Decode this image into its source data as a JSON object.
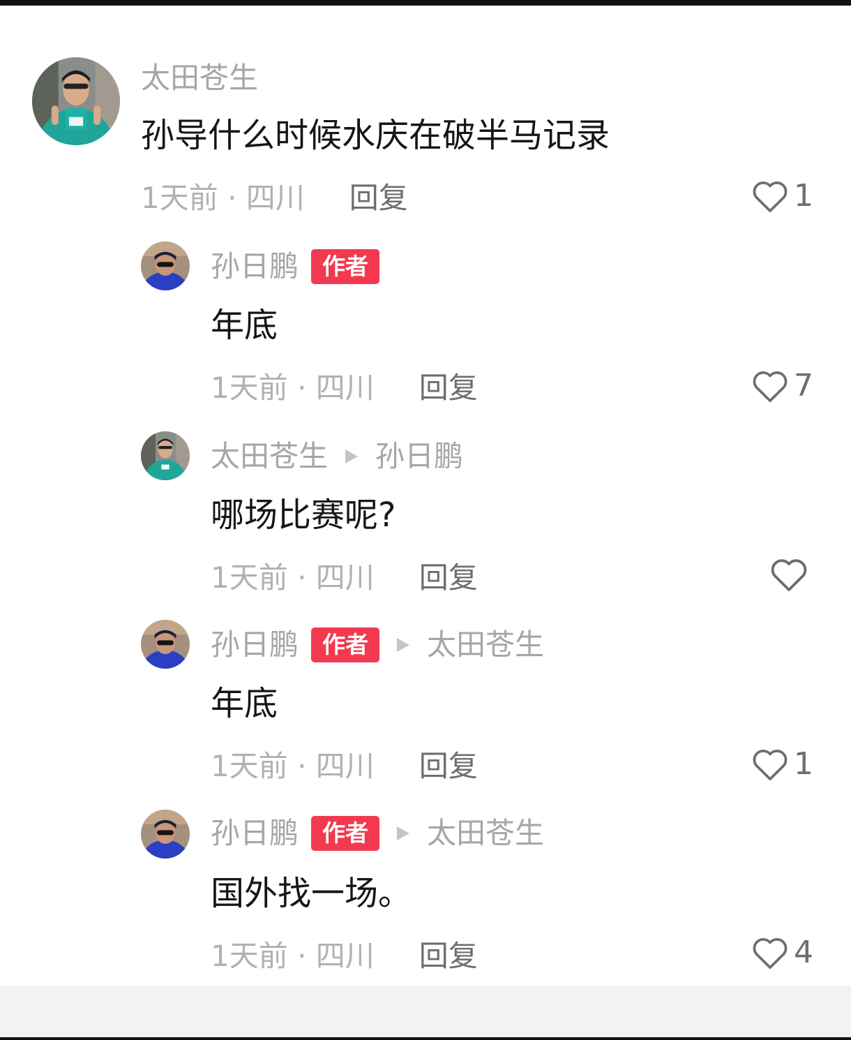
{
  "comments": [
    {
      "avatar": "runner-avatar",
      "username": "太田苍生",
      "is_author": false,
      "reply_to": "",
      "text": "孙导什么时候水庆在破半马记录",
      "meta": "1天前 · 四川",
      "reply_label": "回复",
      "like_count": "1"
    },
    {
      "avatar": "sunglasses-avatar",
      "username": "孙日鹏",
      "is_author": true,
      "author_label": "作者",
      "reply_to": "",
      "text": "年底",
      "meta": "1天前 · 四川",
      "reply_label": "回复",
      "like_count": "7"
    },
    {
      "avatar": "runner-avatar",
      "username": "太田苍生",
      "is_author": false,
      "reply_to": "孙日鹏",
      "text": "哪场比赛呢?",
      "meta": "1天前 · 四川",
      "reply_label": "回复",
      "like_count": ""
    },
    {
      "avatar": "sunglasses-avatar",
      "username": "孙日鹏",
      "is_author": true,
      "author_label": "作者",
      "reply_to": "太田苍生",
      "text": "年底",
      "meta": "1天前 · 四川",
      "reply_label": "回复",
      "like_count": "1"
    },
    {
      "avatar": "sunglasses-avatar",
      "username": "孙日鹏",
      "is_author": true,
      "author_label": "作者",
      "reply_to": "太田苍生",
      "text": "国外找一场。",
      "meta": "1天前 · 四川",
      "reply_label": "回复",
      "like_count": "4"
    }
  ],
  "colors": {
    "author_badge": "#f2394f",
    "username": "#a6a6aa",
    "meta": "#b1b1b5",
    "reply": "#6d6d72",
    "content": "#161616"
  }
}
